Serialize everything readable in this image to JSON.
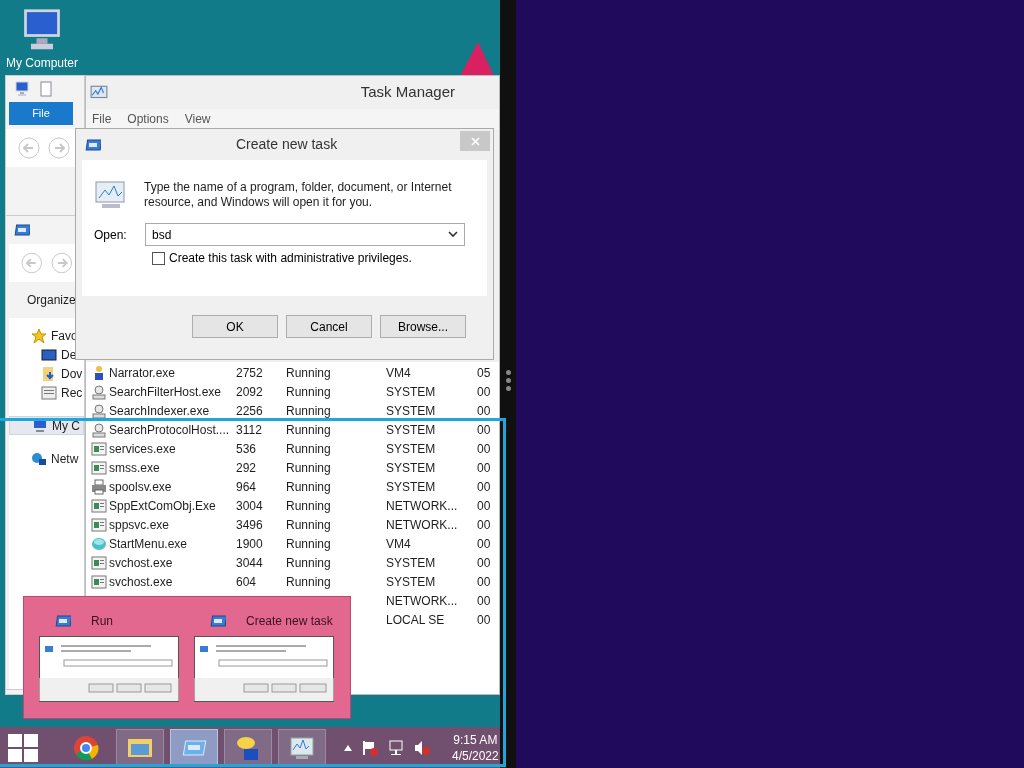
{
  "desktop": {
    "icons": [
      {
        "label": "My Computer"
      }
    ]
  },
  "explorer_back": {
    "ribbon_tab": "File"
  },
  "explorer_front": {
    "toolbar": "Organize",
    "nav": [
      {
        "label": "Favo",
        "kind": "star",
        "selected": false,
        "children": [
          {
            "label": "De",
            "kind": "desktop",
            "selected": false
          },
          {
            "label": "Dov",
            "kind": "download",
            "selected": false
          },
          {
            "label": "Rec",
            "kind": "recent",
            "selected": false
          }
        ]
      },
      {
        "label": "My C",
        "kind": "computer",
        "selected": true
      },
      {
        "label": "Netw",
        "kind": "network",
        "selected": false
      }
    ]
  },
  "task_manager": {
    "title": "Task Manager",
    "menu": [
      "File",
      "Options",
      "View"
    ],
    "rows": [
      {
        "kind": "narrator",
        "name": "Narrator.exe",
        "pid": "2752",
        "status": "Running",
        "user": "VM4",
        "cpu": "05"
      },
      {
        "kind": "search",
        "name": "SearchFilterHost.exe",
        "pid": "2092",
        "status": "Running",
        "user": "SYSTEM",
        "cpu": "00"
      },
      {
        "kind": "search",
        "name": "SearchIndexer.exe",
        "pid": "2256",
        "status": "Running",
        "user": "SYSTEM",
        "cpu": "00"
      },
      {
        "kind": "search",
        "name": "SearchProtocolHost....",
        "pid": "3112",
        "status": "Running",
        "user": "SYSTEM",
        "cpu": "00"
      },
      {
        "kind": "service",
        "name": "services.exe",
        "pid": "536",
        "status": "Running",
        "user": "SYSTEM",
        "cpu": "00"
      },
      {
        "kind": "service",
        "name": "smss.exe",
        "pid": "292",
        "status": "Running",
        "user": "SYSTEM",
        "cpu": "00"
      },
      {
        "kind": "printer",
        "name": "spoolsv.exe",
        "pid": "964",
        "status": "Running",
        "user": "SYSTEM",
        "cpu": "00"
      },
      {
        "kind": "service",
        "name": "SppExtComObj.Exe",
        "pid": "3004",
        "status": "Running",
        "user": "NETWORK...",
        "cpu": "00"
      },
      {
        "kind": "service",
        "name": "sppsvc.exe",
        "pid": "3496",
        "status": "Running",
        "user": "NETWORK...",
        "cpu": "00"
      },
      {
        "kind": "startmenu",
        "name": "StartMenu.exe",
        "pid": "1900",
        "status": "Running",
        "user": "VM4",
        "cpu": "00"
      },
      {
        "kind": "service",
        "name": "svchost.exe",
        "pid": "3044",
        "status": "Running",
        "user": "SYSTEM",
        "cpu": "00"
      },
      {
        "kind": "service",
        "name": "svchost.exe",
        "pid": "604",
        "status": "Running",
        "user": "SYSTEM",
        "cpu": "00"
      },
      {
        "kind": "hidden",
        "user": "NETWORK...",
        "cpu": "00"
      },
      {
        "kind": "hidden",
        "user": "LOCAL SE",
        "cpu": "00"
      }
    ]
  },
  "dialog": {
    "title": "Create new task",
    "message": "Type the name of a program, folder, document, or Internet resource, and Windows will open it for you.",
    "open_label": "Open:",
    "value": "bsd",
    "admin_label": "Create this task with administrative privileges.",
    "admin_checked": false,
    "buttons": [
      "OK",
      "Cancel",
      "Browse..."
    ]
  },
  "previews": [
    {
      "title": "Run"
    },
    {
      "title": "Create new task"
    }
  ],
  "taskbar": {
    "apps": [
      {
        "kind": "chrome",
        "selected": false
      },
      {
        "kind": "explorer",
        "selected": false
      },
      {
        "kind": "run",
        "selected": true
      },
      {
        "kind": "chat",
        "selected": false
      },
      {
        "kind": "taskmgr",
        "selected": false
      }
    ],
    "time": "9:15 AM",
    "date": "4/5/2022"
  }
}
